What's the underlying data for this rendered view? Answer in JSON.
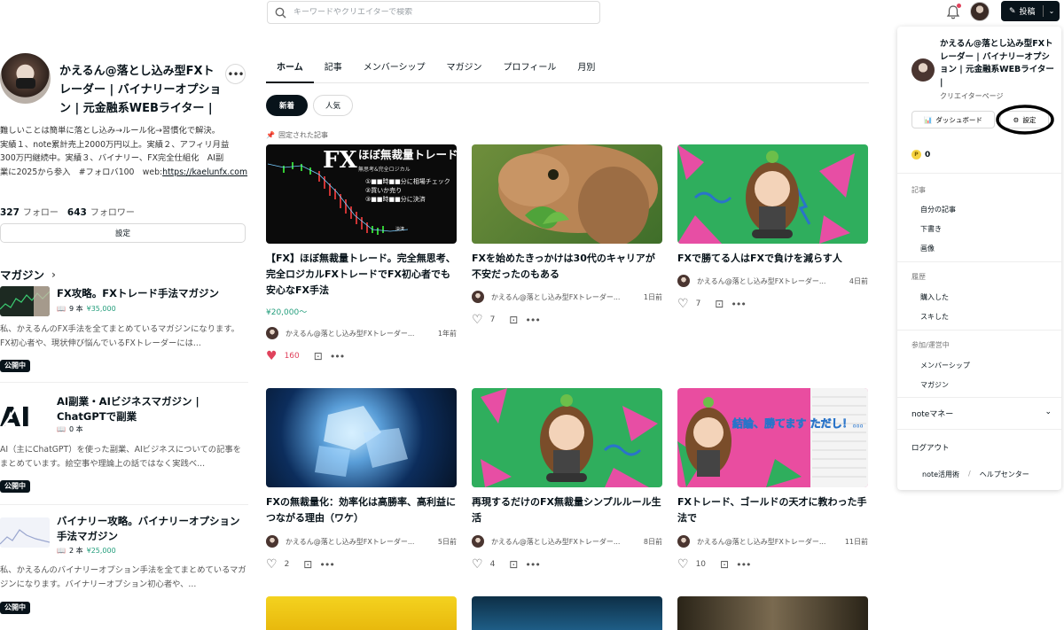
{
  "header": {
    "search_placeholder": "キーワードやクリエイターで検索",
    "post_button": "投稿"
  },
  "profile": {
    "name": "かえるん@落とし込み型FXトレーダー | バイナリーオプション | 元金融系WEBライター |",
    "more": "•••",
    "bio_lines": [
      "難しいことは簡単に落とし込み→ルール化→習慣化で解決。",
      "実績１、note累計売上2000万円以上。実績２、アフィリ月益",
      "300万円継続中。実績３、バイナリー、FX完全仕組化　AI副",
      "業に2025から参入　#フォロバ100　web:"
    ],
    "bio_link": "https://kaelunfx.com",
    "follow_count": "327",
    "follow_label": "フォロー",
    "follower_count": "643",
    "follower_label": "フォロワー",
    "settings_button": "設定"
  },
  "magazines": {
    "heading": "マガジン",
    "items": [
      {
        "title": "FX攻略。FXトレード手法マガジン",
        "count": "9 本",
        "price": "¥35,000",
        "desc": "私、かえるんのFX手法を全てまとめているマガジンになります。FX初心者や、現状伸び悩んでいるFXトレーダーには...",
        "badge": "公開中"
      },
      {
        "title": "AI副業・AIビジネスマガジン | ChatGPTで副業",
        "count": "0 本",
        "price": "",
        "desc": "AI（主にChatGPT）を使った副業、AIビジネスについての記事をまとめています。絵空事や理論上の話ではなく実践べ...",
        "badge": "公開中"
      },
      {
        "title": "バイナリー攻略。バイナリーオプション手法マガジン",
        "count": "2 本",
        "price": "¥25,000",
        "desc": "私、かえるんのバイナリーオプション手法を全てまとめているマガジンになります。バイナリーオプション初心者や、...",
        "badge": "公開中"
      }
    ]
  },
  "tabs": [
    "ホーム",
    "記事",
    "メンバーシップ",
    "マガジン",
    "プロフィール",
    "月別"
  ],
  "filters": {
    "new": "新着",
    "popular": "人気"
  },
  "pinned_label": "固定された記事",
  "thumb_text": {
    "fx_title": "ほぼ無裁量トレード",
    "fx_sub": "無思考&完全ロジカル",
    "fx_steps": [
      "①■■時■■分に相場チェック",
      "②買いか売り",
      "③■■時■■分に決済"
    ],
    "fx_kessai": "決済",
    "fx_logo": "FX",
    "banner": "結論、勝てます ただし！…"
  },
  "articles": [
    {
      "title": "【FX】ほぼ無裁量トレード。完全無思考、完全ロジカルFXトレードでFX初心者でも安心なFX手法",
      "price": "¥20,000〜",
      "author": "かえるん@落とし込み型FXトレーダー...",
      "date": "1年前",
      "likes": "160"
    },
    {
      "title": "FXを始めたきっかけは30代のキャリアが不安だったのもある",
      "price": "",
      "author": "かえるん@落とし込み型FXトレーダー...",
      "date": "1日前",
      "likes": "7"
    },
    {
      "title": "FXで勝てる人はFXで負けを減らす人",
      "price": "",
      "author": "かえるん@落とし込み型FXトレーダー...",
      "date": "4日前",
      "likes": "7"
    },
    {
      "title": "FXの無裁量化：効率化は高勝率、高利益につながる理由（ワケ）",
      "price": "",
      "author": "かえるん@落とし込み型FXトレーダー...",
      "date": "5日前",
      "likes": "2"
    },
    {
      "title": "再現するだけのFX無裁量シンプルルール生活",
      "price": "",
      "author": "かえるん@落とし込み型FXトレーダー...",
      "date": "8日前",
      "likes": "4"
    },
    {
      "title": "FXトレード、ゴールドの天才に教わった手法で",
      "price": "",
      "author": "かえるん@落とし込み型FXトレーダー...",
      "date": "11日前",
      "likes": "10"
    }
  ],
  "menu": {
    "name": "かえるん@落とし込み型FXトレーダー | バイナリーオプション | 元金融系WEBライター |",
    "sub": "クリエイターページ",
    "dashboard": "ダッシュボード",
    "settings": "設定",
    "points_icon": "P",
    "points": "0",
    "sec_article": "記事",
    "my_articles": "自分の記事",
    "drafts": "下書き",
    "images": "画像",
    "sec_history": "履歴",
    "purchased": "購入した",
    "liked": "スキした",
    "sec_joined": "参加/運営中",
    "membership": "メンバーシップ",
    "magazine": "マガジン",
    "money": "noteマネー",
    "logout": "ログアウト",
    "tips": "note活用術",
    "slash": "/",
    "help": "ヘルプセンター"
  }
}
